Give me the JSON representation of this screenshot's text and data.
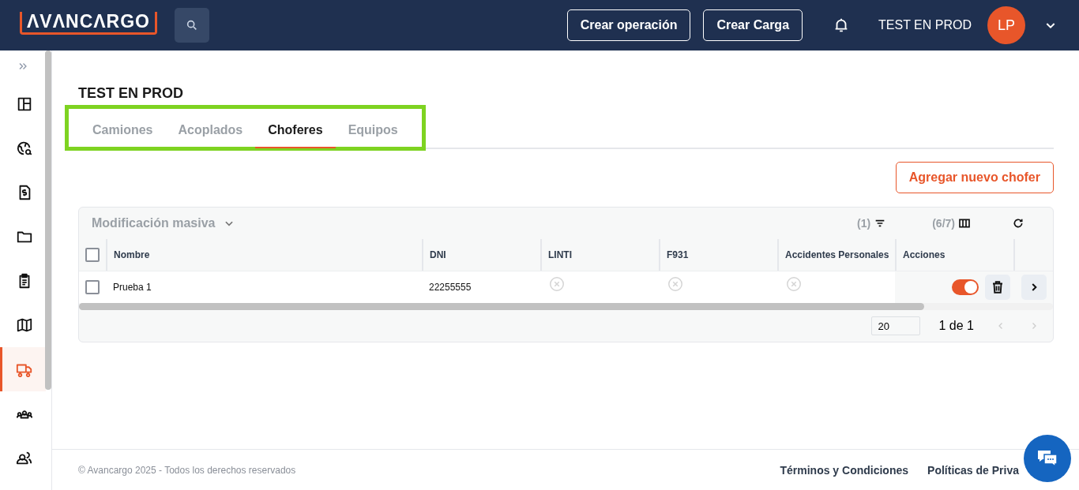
{
  "header": {
    "logo": "ΛVΛNCΛRGO",
    "buttons": [
      "Crear operación",
      "Crear Carga"
    ],
    "company": "TEST EN PROD",
    "avatar": "LP"
  },
  "sidebar": {
    "items": [
      {
        "selected": false
      },
      {
        "selected": false
      },
      {
        "selected": false
      },
      {
        "selected": false
      },
      {
        "selected": false
      },
      {
        "selected": false
      },
      {
        "selected": true
      },
      {
        "selected": false
      },
      {
        "selected": false
      }
    ]
  },
  "page": {
    "title": "TEST EN PROD",
    "tabs_highlighted": true,
    "tabs": [
      {
        "label": "Camiones",
        "selected": false
      },
      {
        "label": "Acoplados",
        "selected": false
      },
      {
        "label": "Choferes",
        "selected": true
      },
      {
        "label": "Equipos",
        "selected": false
      }
    ],
    "add_button": "Agregar nuevo chofer"
  },
  "table": {
    "bulk_action": "Modificación masiva",
    "filter_count": "(1)",
    "columns_count": "(6/7)",
    "all_checked": false,
    "columns": [
      "Nombre",
      "DNI",
      "LINTI",
      "F931",
      "Accidentes Personales",
      "Acciones"
    ],
    "rows": [
      {
        "checked": false,
        "nombre": "Prueba 1",
        "dni": "22255555",
        "linti": false,
        "f931": false,
        "accidentes": false,
        "active": true
      }
    ],
    "page_size": "20",
    "pagination": "1 de 1"
  },
  "footer": {
    "copyright": "© Avancargo 2025 - Todos los derechos reservados",
    "links": [
      "Términos y Condiciones",
      "Políticas de Priva"
    ]
  }
}
